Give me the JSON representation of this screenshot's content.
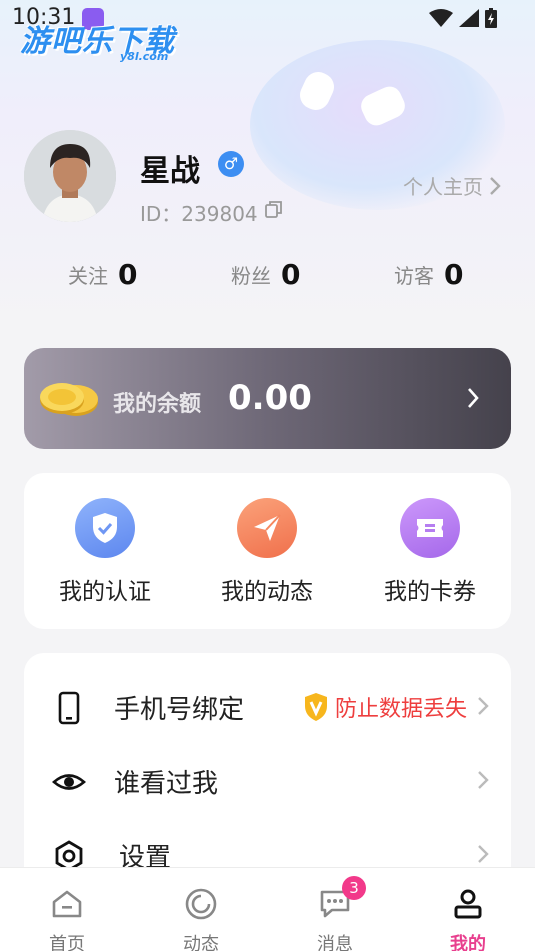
{
  "status_bar": {
    "time": "10:31"
  },
  "watermark": {
    "title": "游吧乐下载",
    "sub": "y8l.com"
  },
  "profile": {
    "name": "星战",
    "gender_symbol": "♂",
    "id_text": "ID：239804",
    "homepage_label": "个人主页"
  },
  "stats": [
    {
      "label": "关注",
      "value": "0"
    },
    {
      "label": "粉丝",
      "value": "0"
    },
    {
      "label": "访客",
      "value": "0"
    }
  ],
  "balance": {
    "label": "我的余额",
    "value": "0.00"
  },
  "quick_actions": [
    {
      "label": "我的认证",
      "icon": "shield-check-icon",
      "color": "#6f97f4"
    },
    {
      "label": "我的动态",
      "icon": "paper-plane-icon",
      "color": "#f6875e"
    },
    {
      "label": "我的卡券",
      "icon": "ticket-icon",
      "color": "#b57ef0"
    }
  ],
  "menu": [
    {
      "label": "手机号绑定",
      "icon": "phone-icon",
      "note": "防止数据丢失"
    },
    {
      "label": "谁看过我",
      "icon": "eye-icon"
    },
    {
      "label": "设置",
      "icon": "settings-icon"
    }
  ],
  "tabs": [
    {
      "label": "首页",
      "icon": "home-icon"
    },
    {
      "label": "动态",
      "icon": "moments-icon"
    },
    {
      "label": "消息",
      "icon": "message-icon",
      "badge": "3"
    },
    {
      "label": "我的",
      "icon": "profile-icon",
      "active": true
    }
  ],
  "colors": {
    "accent": "#e83f8e",
    "warning": "#ee3e3e",
    "gender": "#3d8ef2"
  }
}
